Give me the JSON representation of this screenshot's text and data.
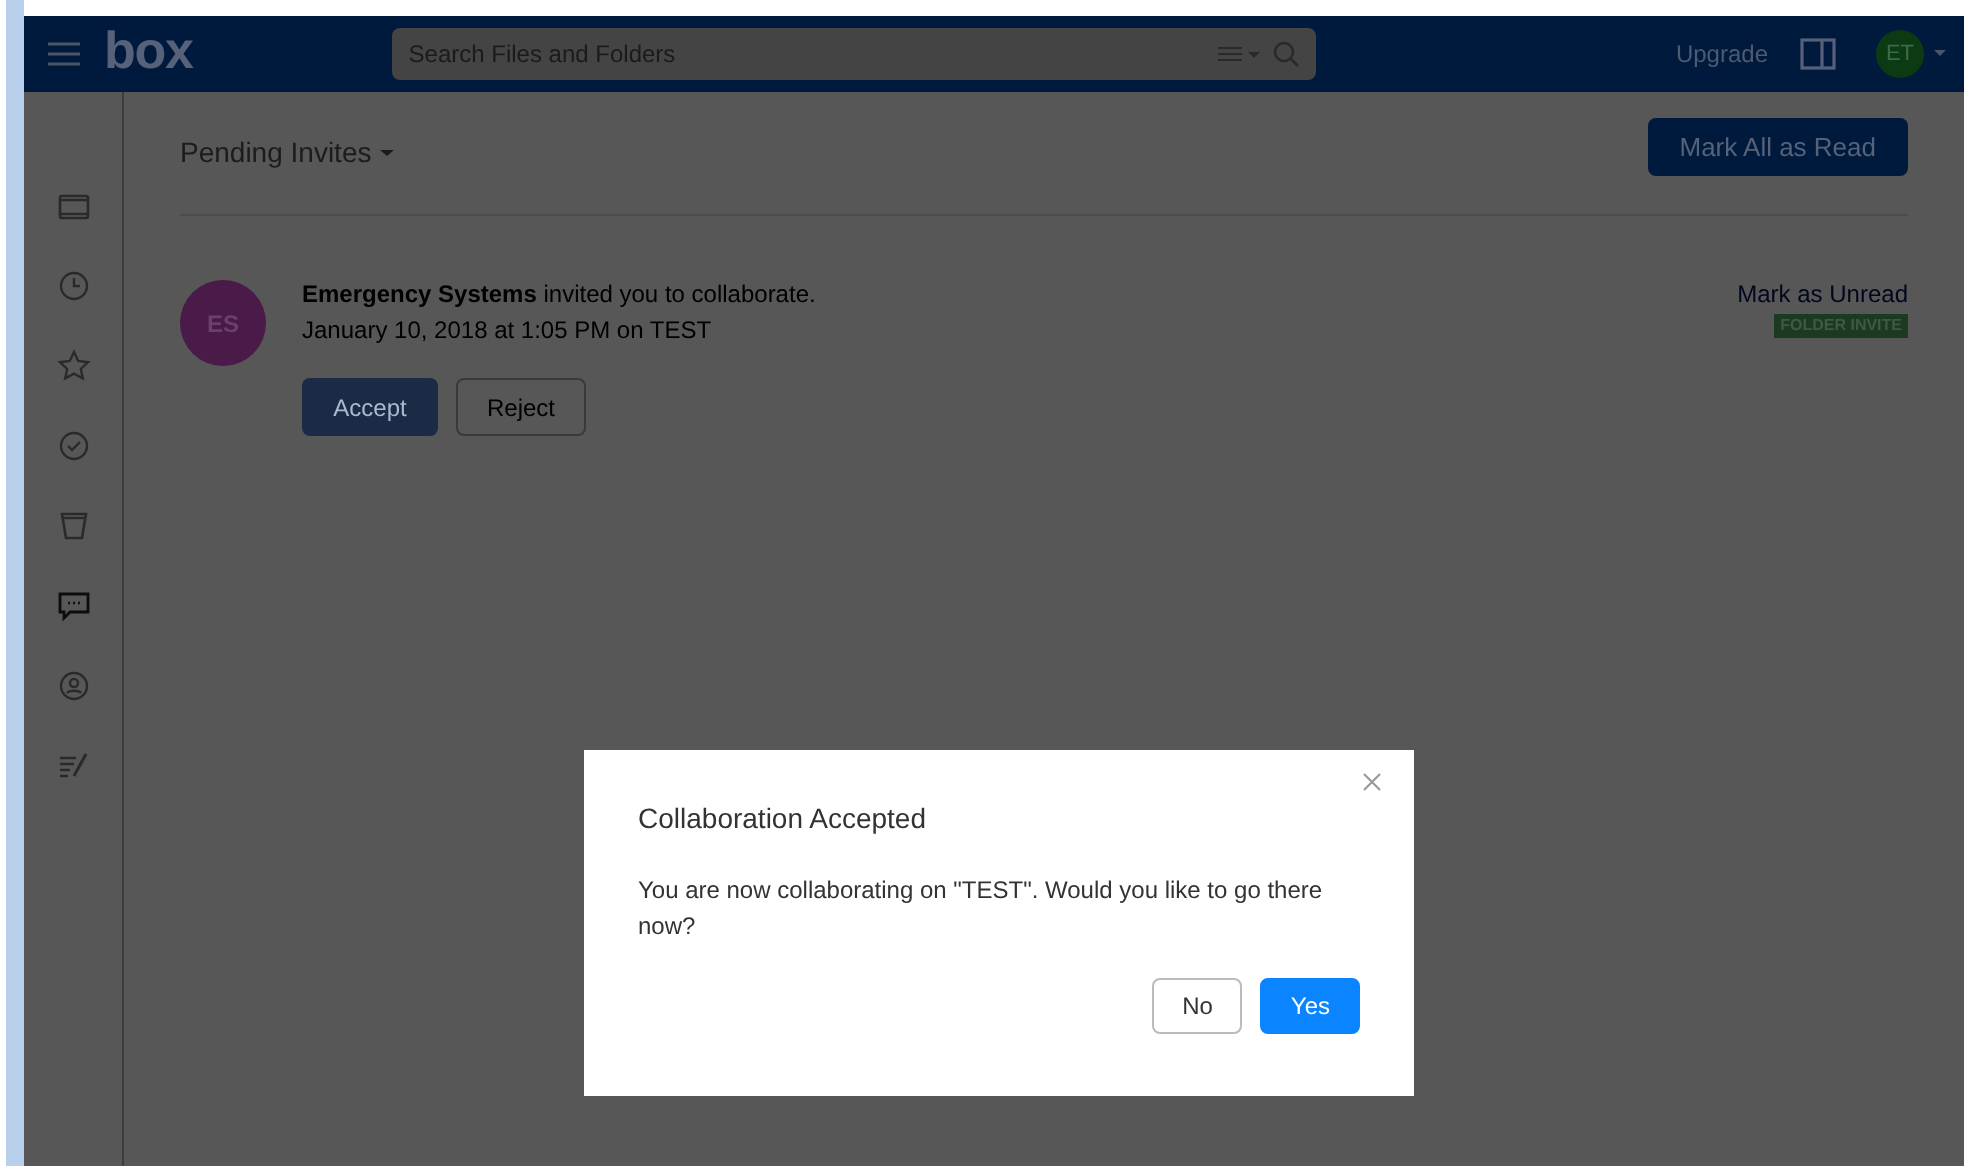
{
  "header": {
    "logo": "box",
    "search": {
      "placeholder": "Search Files and Folders"
    },
    "upgrade": "Upgrade",
    "avatar": "ET"
  },
  "sidebar": {
    "items": [
      {
        "kind": "folder",
        "selected": false
      },
      {
        "kind": "clock",
        "selected": false
      },
      {
        "kind": "star",
        "selected": false
      },
      {
        "kind": "check",
        "selected": false
      },
      {
        "kind": "trash",
        "selected": false
      },
      {
        "kind": "chat",
        "selected": true
      },
      {
        "kind": "user",
        "selected": false
      },
      {
        "kind": "notes",
        "selected": false
      }
    ]
  },
  "page": {
    "title": "Pending Invites",
    "mark_all_button": "Mark All as Read"
  },
  "invites": [
    {
      "avatar": "ES",
      "message": "**Emergency Systems** invited you to collaborate.",
      "meta": "January 10, 2018 at 1:05 PM on TEST",
      "accept": "Accept",
      "reject": "Reject",
      "mark_unread": "Mark as Unread",
      "tag": "FOLDER INVITE"
    }
  ],
  "dialog": {
    "title": "Collaboration Accepted",
    "message": "You are now collaborating on \"TEST\". Would you like to go there now?",
    "buttons": [
      {
        "label": "No",
        "kind": "secondary"
      },
      {
        "label": "Yes",
        "kind": "primary"
      }
    ]
  }
}
